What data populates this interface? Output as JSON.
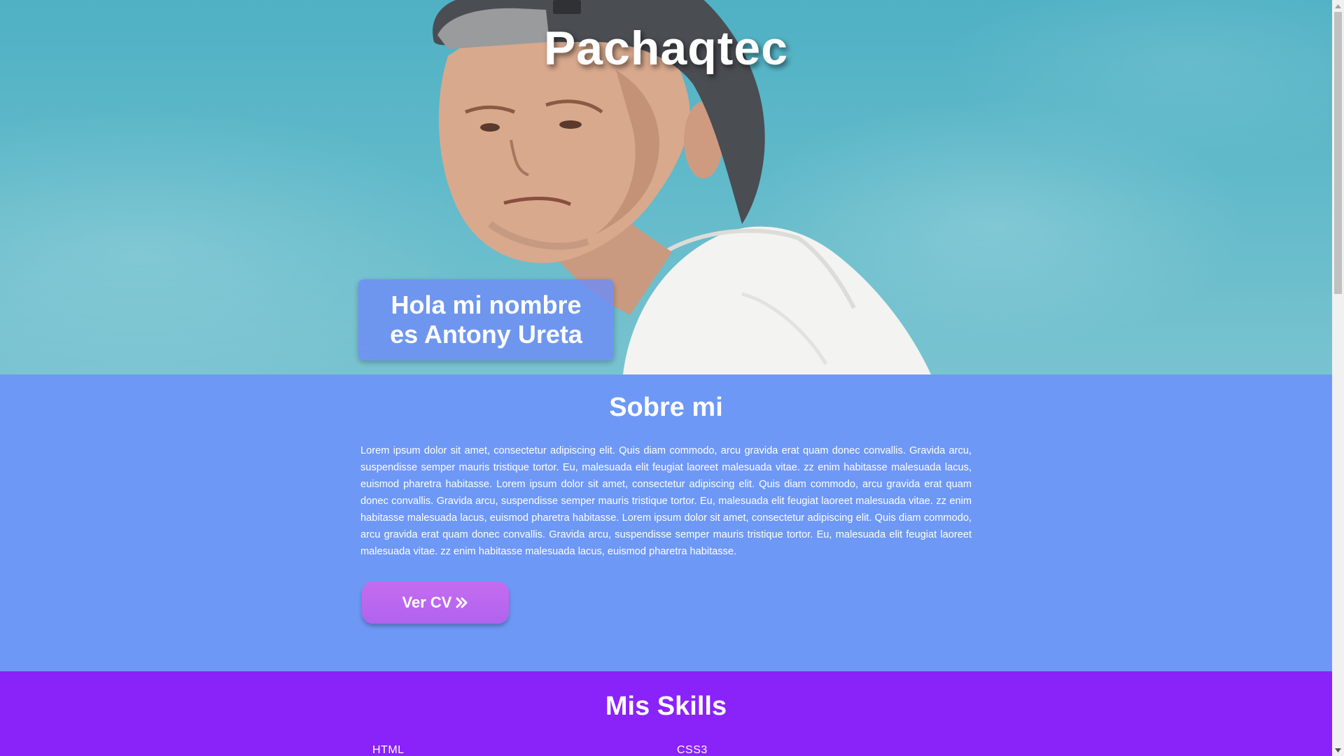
{
  "hero": {
    "title": "Pachaqtec",
    "intro_line1": "Hola mi nombre",
    "intro_line2": "es Antony Ureta"
  },
  "about": {
    "title": "Sobre mi",
    "paragraph": "Lorem ipsum dolor sit amet, consectetur adipiscing elit. Quis diam commodo, arcu gravida erat quam donec convallis. Gravida arcu, suspendisse semper mauris tristique tortor. Eu, malesuada elit feugiat laoreet malesuada vitae. zz enim habitasse malesuada lacus, euismod pharetra habitasse. Lorem ipsum dolor sit amet, consectetur adipiscing elit. Quis diam commodo, arcu gravida erat quam donec convallis. Gravida arcu, suspendisse semper mauris tristique tortor. Eu, malesuada elit feugiat laoreet malesuada vitae. zz enim habitasse malesuada lacus, euismod pharetra habitasse. Lorem ipsum dolor sit amet, consectetur adipiscing elit. Quis diam commodo, arcu gravida erat quam donec convallis. Gravida arcu, suspendisse semper mauris tristique tortor. Eu, malesuada elit feugiat laoreet malesuada vitae. zz enim habitasse malesuada lacus, euismod pharetra habitasse.",
    "cv_button_label": "Ver CV",
    "cv_button_icon": "double-chevron-right-icon"
  },
  "skills": {
    "title": "Mis Skills",
    "items": [
      {
        "label": "HTML"
      },
      {
        "label": "CSS3"
      }
    ]
  },
  "colors": {
    "about_bg": "#6e98f6",
    "skills_bg": "#8a22fa",
    "button_bg": "#c56cf0",
    "intro_card_bg": "#6e8cf5"
  }
}
